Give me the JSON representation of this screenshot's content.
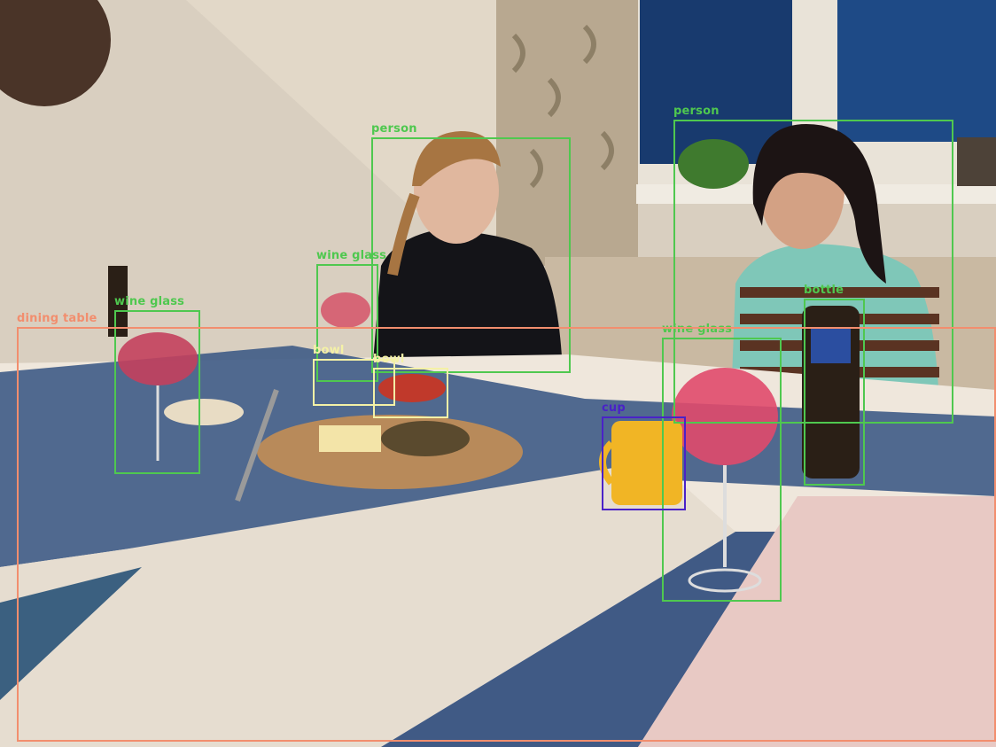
{
  "colors": {
    "person": "#4fc84f",
    "wine_glass": "#4fc84f",
    "bottle": "#4fc84f",
    "bowl": "#f4f1a6",
    "cup": "#4a22c8",
    "dining_table": "#f28e6e"
  },
  "detections": [
    {
      "label": "person",
      "color_key": "person"
    },
    {
      "label": "person",
      "color_key": "person"
    },
    {
      "label": "wine glass",
      "color_key": "wine_glass"
    },
    {
      "label": "wine glass",
      "color_key": "wine_glass"
    },
    {
      "label": "wine glass",
      "color_key": "wine_glass"
    },
    {
      "label": "bowl",
      "color_key": "bowl"
    },
    {
      "label": "bowl",
      "color_key": "bowl"
    },
    {
      "label": "cup",
      "color_key": "cup"
    },
    {
      "label": "bottle",
      "color_key": "bottle"
    },
    {
      "label": "dining table",
      "color_key": "dining_table"
    }
  ]
}
